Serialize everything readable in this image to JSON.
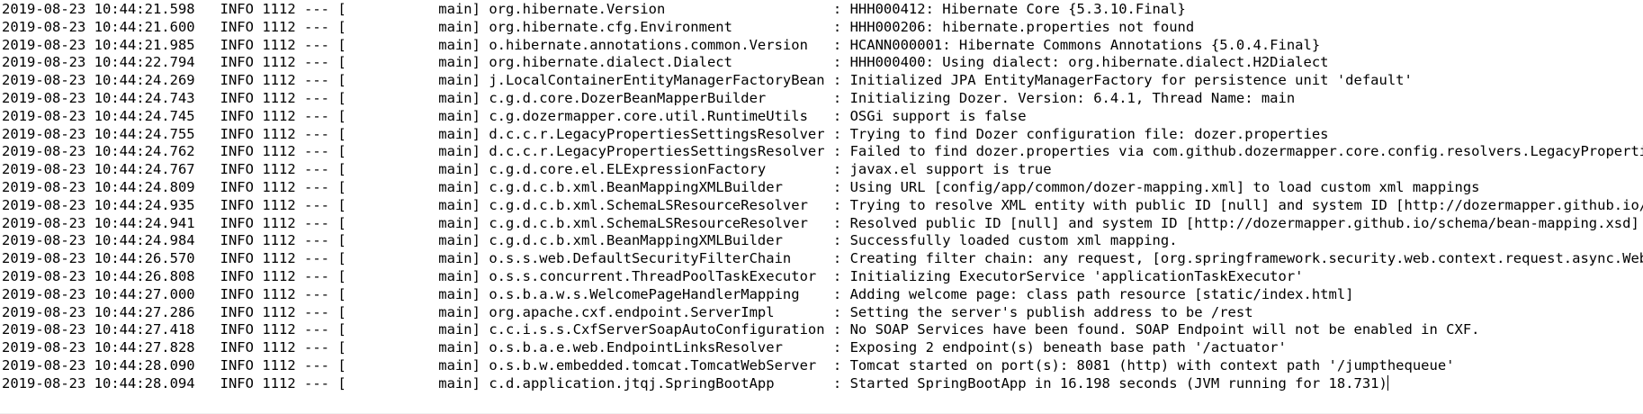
{
  "console": {
    "lines": [
      {
        "ts": "2019-08-23 10:44:21.598",
        "level": "INFO",
        "pid": "1112",
        "thread": "main",
        "logger": "org.hibernate.Version",
        "msg": "HHH000412: Hibernate Core {5.3.10.Final}"
      },
      {
        "ts": "2019-08-23 10:44:21.600",
        "level": "INFO",
        "pid": "1112",
        "thread": "main",
        "logger": "org.hibernate.cfg.Environment",
        "msg": "HHH000206: hibernate.properties not found"
      },
      {
        "ts": "2019-08-23 10:44:21.985",
        "level": "INFO",
        "pid": "1112",
        "thread": "main",
        "logger": "o.hibernate.annotations.common.Version",
        "msg": "HCANN000001: Hibernate Commons Annotations {5.0.4.Final}"
      },
      {
        "ts": "2019-08-23 10:44:22.794",
        "level": "INFO",
        "pid": "1112",
        "thread": "main",
        "logger": "org.hibernate.dialect.Dialect",
        "msg": "HHH000400: Using dialect: org.hibernate.dialect.H2Dialect"
      },
      {
        "ts": "2019-08-23 10:44:24.269",
        "level": "INFO",
        "pid": "1112",
        "thread": "main",
        "logger": "j.LocalContainerEntityManagerFactoryBean",
        "msg": "Initialized JPA EntityManagerFactory for persistence unit 'default'"
      },
      {
        "ts": "2019-08-23 10:44:24.743",
        "level": "INFO",
        "pid": "1112",
        "thread": "main",
        "logger": "c.g.d.core.DozerBeanMapperBuilder",
        "msg": "Initializing Dozer. Version: 6.4.1, Thread Name: main"
      },
      {
        "ts": "2019-08-23 10:44:24.745",
        "level": "INFO",
        "pid": "1112",
        "thread": "main",
        "logger": "c.g.dozermapper.core.util.RuntimeUtils",
        "msg": "OSGi support is false"
      },
      {
        "ts": "2019-08-23 10:44:24.755",
        "level": "INFO",
        "pid": "1112",
        "thread": "main",
        "logger": "d.c.c.r.LegacyPropertiesSettingsResolver",
        "msg": "Trying to find Dozer configuration file: dozer.properties"
      },
      {
        "ts": "2019-08-23 10:44:24.762",
        "level": "INFO",
        "pid": "1112",
        "thread": "main",
        "logger": "d.c.c.r.LegacyPropertiesSettingsResolver",
        "msg": "Failed to find dozer.properties via com.github.dozermapper.core.config.resolvers.LegacyPropertiesSettin"
      },
      {
        "ts": "2019-08-23 10:44:24.767",
        "level": "INFO",
        "pid": "1112",
        "thread": "main",
        "logger": "c.g.d.core.el.ELExpressionFactory",
        "msg": "javax.el support is true"
      },
      {
        "ts": "2019-08-23 10:44:24.809",
        "level": "INFO",
        "pid": "1112",
        "thread": "main",
        "logger": "c.g.d.c.b.xml.BeanMappingXMLBuilder",
        "msg": "Using URL [config/app/common/dozer-mapping.xml] to load custom xml mappings"
      },
      {
        "ts": "2019-08-23 10:44:24.935",
        "level": "INFO",
        "pid": "1112",
        "thread": "main",
        "logger": "c.g.d.c.b.xml.SchemaLSResourceResolver",
        "msg": "Trying to resolve XML entity with public ID [null] and system ID [http://dozermapper.github.io/schema/l"
      },
      {
        "ts": "2019-08-23 10:44:24.941",
        "level": "INFO",
        "pid": "1112",
        "thread": "main",
        "logger": "c.g.d.c.b.xml.SchemaLSResourceResolver",
        "msg": "Resolved public ID [null] and system ID [http://dozermapper.github.io/schema/bean-mapping.xsd]"
      },
      {
        "ts": "2019-08-23 10:44:24.984",
        "level": "INFO",
        "pid": "1112",
        "thread": "main",
        "logger": "c.g.d.c.b.xml.BeanMappingXMLBuilder",
        "msg": "Successfully loaded custom xml mapping."
      },
      {
        "ts": "2019-08-23 10:44:26.570",
        "level": "INFO",
        "pid": "1112",
        "thread": "main",
        "logger": "o.s.s.web.DefaultSecurityFilterChain",
        "msg": "Creating filter chain: any request, [org.springframework.security.web.context.request.async.WebAsyncMan"
      },
      {
        "ts": "2019-08-23 10:44:26.808",
        "level": "INFO",
        "pid": "1112",
        "thread": "main",
        "logger": "o.s.s.concurrent.ThreadPoolTaskExecutor",
        "msg": "Initializing ExecutorService 'applicationTaskExecutor'"
      },
      {
        "ts": "2019-08-23 10:44:27.000",
        "level": "INFO",
        "pid": "1112",
        "thread": "main",
        "logger": "o.s.b.a.w.s.WelcomePageHandlerMapping",
        "msg": "Adding welcome page: class path resource [static/index.html]"
      },
      {
        "ts": "2019-08-23 10:44:27.286",
        "level": "INFO",
        "pid": "1112",
        "thread": "main",
        "logger": "org.apache.cxf.endpoint.ServerImpl",
        "msg": "Setting the server's publish address to be /rest"
      },
      {
        "ts": "2019-08-23 10:44:27.418",
        "level": "INFO",
        "pid": "1112",
        "thread": "main",
        "logger": "c.c.i.s.s.CxfServerSoapAutoConfiguration",
        "msg": "No SOAP Services have been found. SOAP Endpoint will not be enabled in CXF."
      },
      {
        "ts": "2019-08-23 10:44:27.828",
        "level": "INFO",
        "pid": "1112",
        "thread": "main",
        "logger": "o.s.b.a.e.web.EndpointLinksResolver",
        "msg": "Exposing 2 endpoint(s) beneath base path '/actuator'"
      },
      {
        "ts": "2019-08-23 10:44:28.090",
        "level": "INFO",
        "pid": "1112",
        "thread": "main",
        "logger": "o.s.b.w.embedded.tomcat.TomcatWebServer",
        "msg": "Tomcat started on port(s): 8081 (http) with context path '/jumpthequeue'"
      },
      {
        "ts": "2019-08-23 10:44:28.094",
        "level": "INFO",
        "pid": "1112",
        "thread": "main",
        "logger": "c.d.application.jtqj.SpringBootApp",
        "msg": "Started SpringBootApp in 16.198 seconds (JVM running for 18.731)"
      }
    ]
  }
}
